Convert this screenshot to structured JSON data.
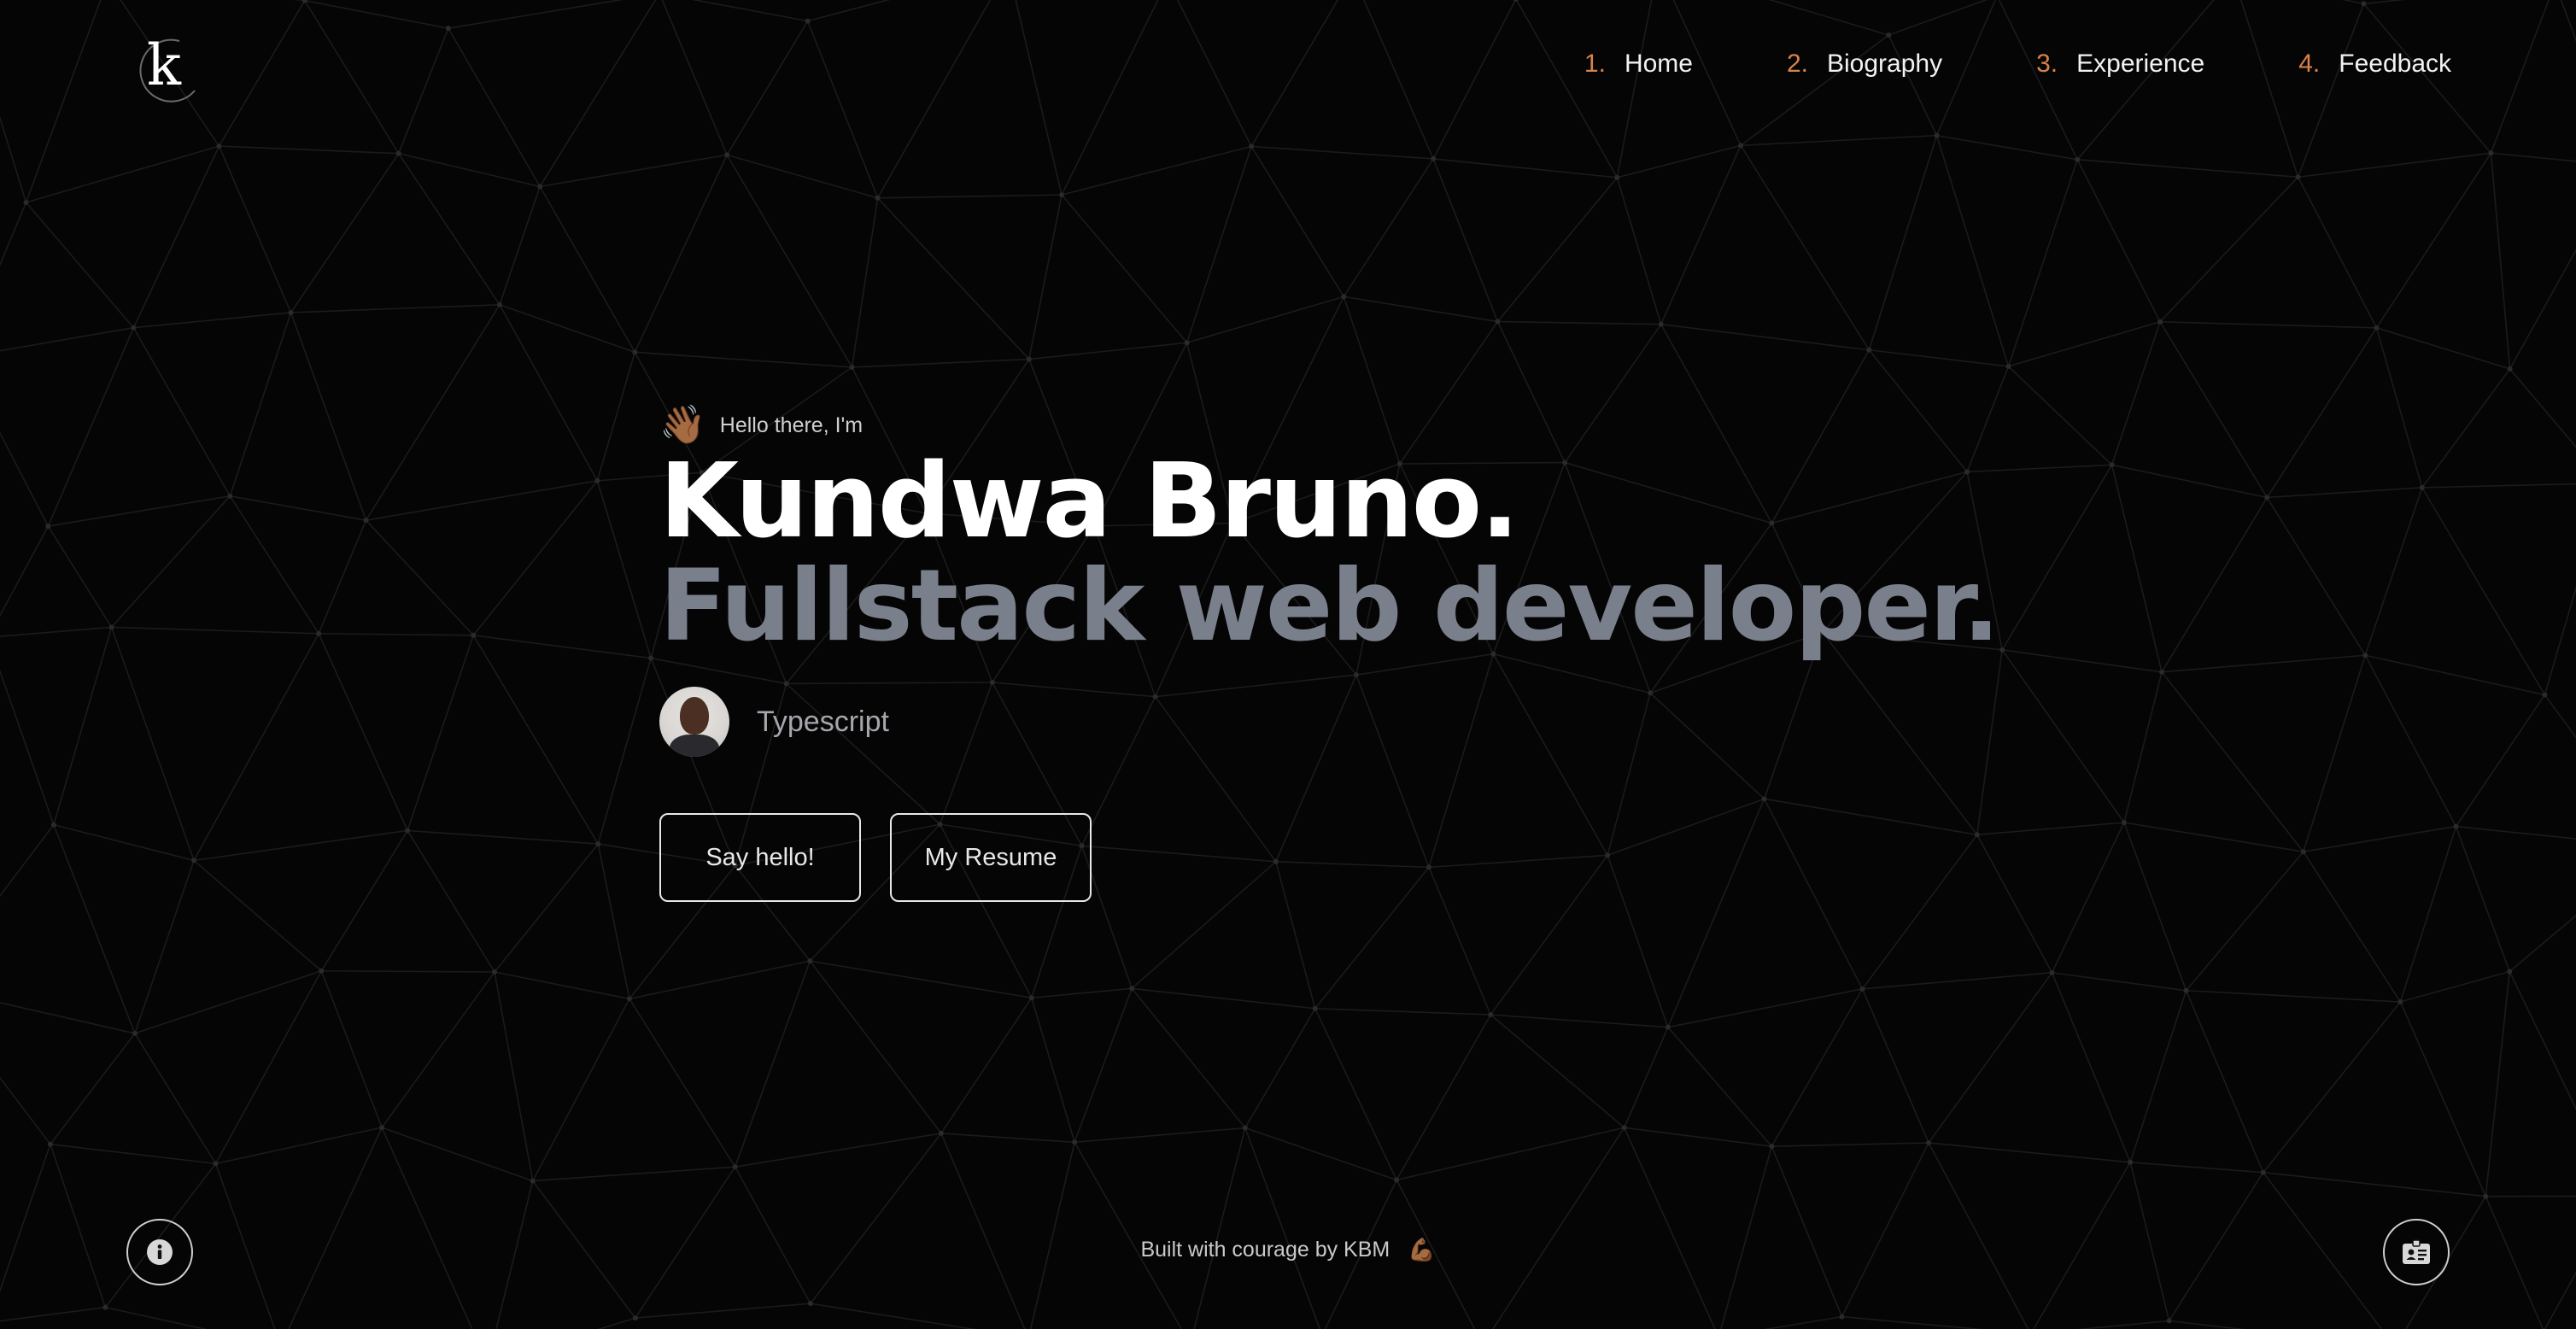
{
  "logo": {
    "letter": "k"
  },
  "nav": {
    "items": [
      {
        "num": "1.",
        "label": "Home"
      },
      {
        "num": "2.",
        "label": "Biography"
      },
      {
        "num": "3.",
        "label": "Experience"
      },
      {
        "num": "4.",
        "label": "Feedback"
      }
    ]
  },
  "hero": {
    "greeting_icon": "waving-hand-icon",
    "greeting": "Hello there, I'm",
    "name": "Kundwa Bruno.",
    "role": "Fullstack web developer.",
    "tech": "Typescript",
    "buttons": {
      "say_hello": "Say hello!",
      "resume": "My Resume"
    }
  },
  "footer": {
    "text": "Built with courage by KBM",
    "text_icon": "flexed-biceps-icon",
    "left_icon": "info-icon",
    "right_icon": "id-badge-icon"
  },
  "colors": {
    "background": "#000000",
    "accent": "#d9824b",
    "name": "#ffffff",
    "role": "#7a7f8c",
    "muted": "#a5a7ad"
  }
}
